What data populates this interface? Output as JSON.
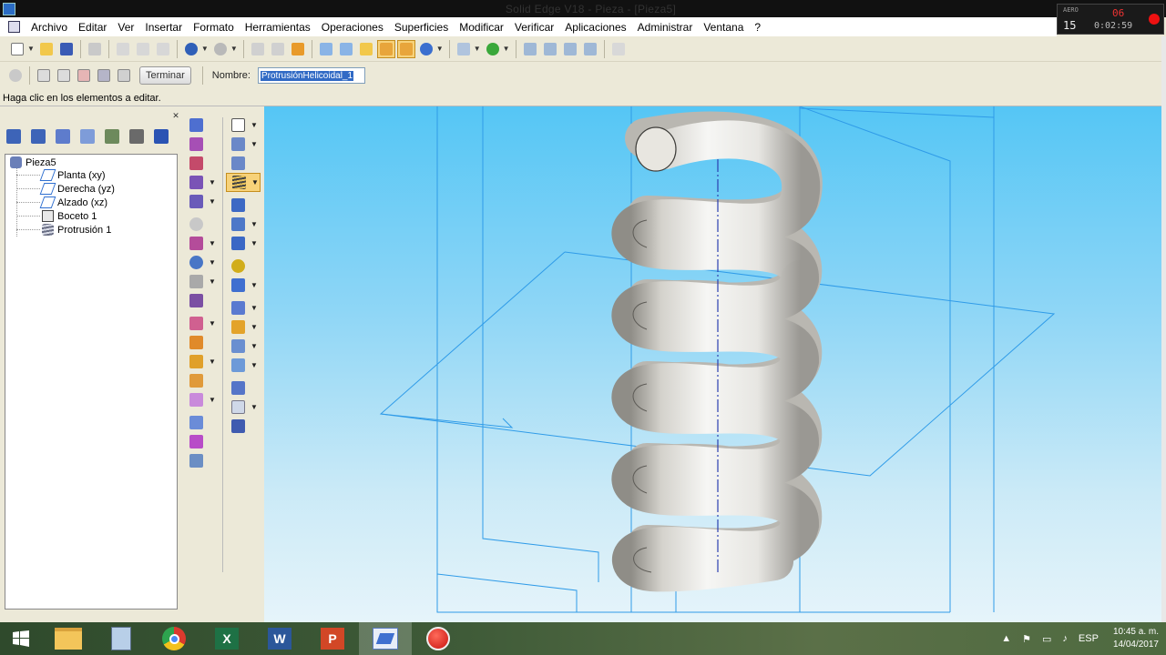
{
  "window": {
    "title": "Solid Edge V18 - Pieza - [Pieza5]"
  },
  "menu": {
    "items": [
      "Archivo",
      "Editar",
      "Ver",
      "Insertar",
      "Formato",
      "Herramientas",
      "Operaciones",
      "Superficies",
      "Modificar",
      "Verificar",
      "Aplicaciones",
      "Administrar",
      "Ventana",
      "?"
    ]
  },
  "recorder": {
    "brand": "AERO",
    "small_counter": "06",
    "big_counter": "15",
    "elapsed": "0:02:59"
  },
  "command_bar": {
    "finish_label": "Terminar",
    "name_label": "Nombre:",
    "name_value": "ProtrusiónHelicoidal_1"
  },
  "status": {
    "prompt": "Haga clic en los elementos a editar."
  },
  "feature_tree": {
    "root": "Pieza5",
    "items": [
      {
        "label": "Planta (xy)",
        "icon": "reference-plane-icon"
      },
      {
        "label": "Derecha (yz)",
        "icon": "reference-plane-icon"
      },
      {
        "label": "Alzado (xz)",
        "icon": "reference-plane-icon"
      },
      {
        "label": "Boceto 1",
        "icon": "sketch-icon"
      },
      {
        "label": "Protrusión 1",
        "icon": "helical-protrusion-icon"
      }
    ]
  },
  "colors": {
    "viewport_top": "#55c6f5",
    "viewport_bottom": "#e6f4fa",
    "reference_plane": "#2f9be8",
    "spring_light": "#f4f4f2",
    "spring_dark": "#8e8c86",
    "axis": "#2a3fb0"
  },
  "taskbar": {
    "apps": [
      "file-explorer-icon",
      "calculator-icon",
      "chrome-icon",
      "excel-icon",
      "word-icon",
      "powerpoint-icon",
      "solid-edge-icon",
      "screen-recorder-icon"
    ],
    "language": "ESP",
    "time": "10:45 a. m.",
    "date": "14/04/2017"
  }
}
